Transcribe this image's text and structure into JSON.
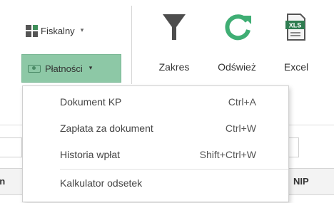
{
  "ribbon": {
    "fiskalny": {
      "label": "Fiskalny",
      "icon": "grid-icon",
      "caret": "▾"
    },
    "platnosci": {
      "label": "Płatności",
      "icon": "money-icon",
      "caret": "▾",
      "active_color": "#8dc8a6"
    },
    "zakres": {
      "label": "Zakres",
      "icon": "filter-icon"
    },
    "odswiez": {
      "label": "Odśwież",
      "icon": "refresh-icon",
      "icon_color": "#3fae74"
    },
    "excel": {
      "label": "Excel",
      "icon": "xls-file-icon",
      "icon_text": "XLS"
    }
  },
  "dropdown": {
    "items": [
      {
        "label": "Dokument KP",
        "shortcut": "Ctrl+A"
      },
      {
        "label": "Zapłata za dokument",
        "shortcut": "Ctrl+W"
      },
      {
        "label": "Historia wpłat",
        "shortcut": "Shift+Ctrl+W"
      },
      {
        "label": "Kalkulator odsetek",
        "shortcut": ""
      }
    ]
  },
  "grid": {
    "columns": {
      "left_fragment": "en",
      "nip": "NIP"
    }
  }
}
